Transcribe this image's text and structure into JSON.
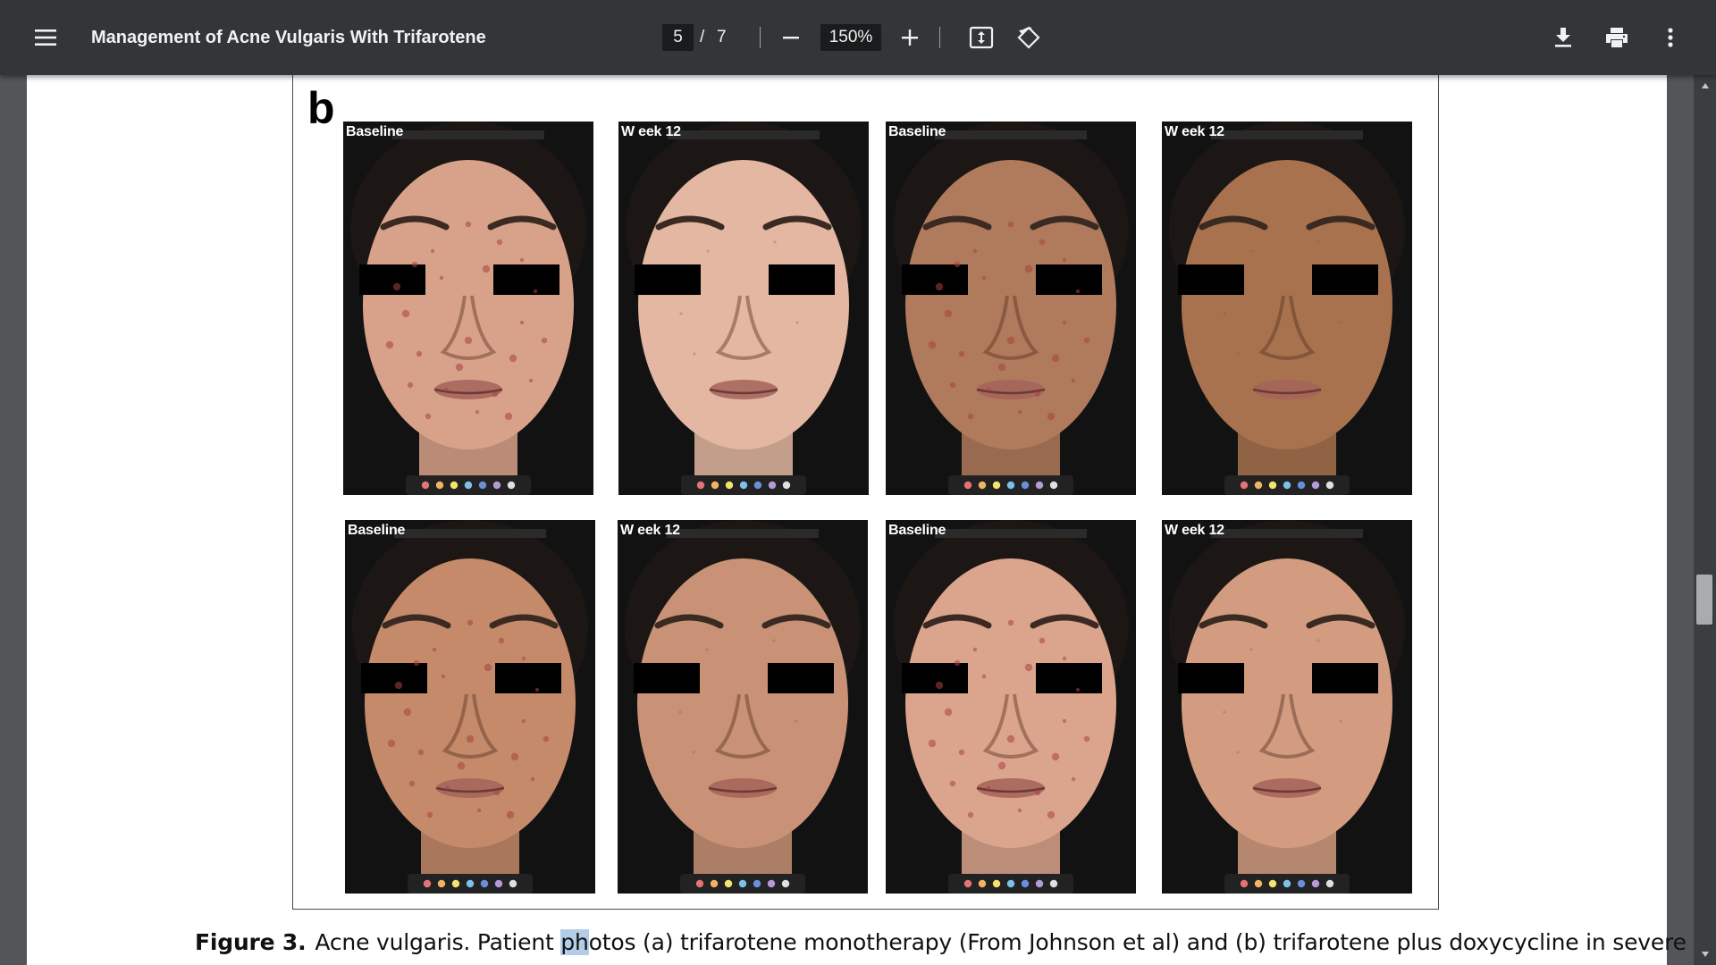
{
  "toolbar": {
    "menu_icon": "hamburger-menu-icon",
    "title": "Management of Acne Vulgaris With Trifarotene",
    "current_page": "5",
    "page_separator": "/",
    "total_pages": "7",
    "zoom_out_icon": "minus-icon",
    "zoom_level": "150%",
    "zoom_in_icon": "plus-icon",
    "fit_icon": "fit-to-page-icon",
    "rotate_icon": "rotate-counterclockwise-icon",
    "download_icon": "download-icon",
    "print_icon": "print-icon",
    "more_icon": "more-vertical-icon"
  },
  "figure": {
    "panel_letter": "b",
    "photos": [
      {
        "label": "Baseline",
        "skin": "#d8a28a",
        "lesions": true
      },
      {
        "label": "W eek 12",
        "skin": "#e3b7a1",
        "lesions": false
      },
      {
        "label": "Baseline",
        "skin": "#b07a5c",
        "lesions": true
      },
      {
        "label": "W eek 12",
        "skin": "#a8724f",
        "lesions": false
      },
      {
        "label": "Baseline",
        "skin": "#c48a6a",
        "lesions": true
      },
      {
        "label": "W eek 12",
        "skin": "#c99276",
        "lesions": false
      },
      {
        "label": "Baseline",
        "skin": "#dba48c",
        "lesions": true
      },
      {
        "label": "W eek 12",
        "skin": "#d39c80",
        "lesions": false
      }
    ]
  },
  "caption": {
    "figure_label": "Figure 3.",
    "text_before": "Acne vulgaris. Patient ",
    "highlighted": "ph",
    "text_after": "otos (a) trifarotene monotherapy (From Johnson et al) and (b) trifarotene plus doxycycline in severe"
  },
  "scrollbar": {
    "position_fraction": 0.6
  }
}
